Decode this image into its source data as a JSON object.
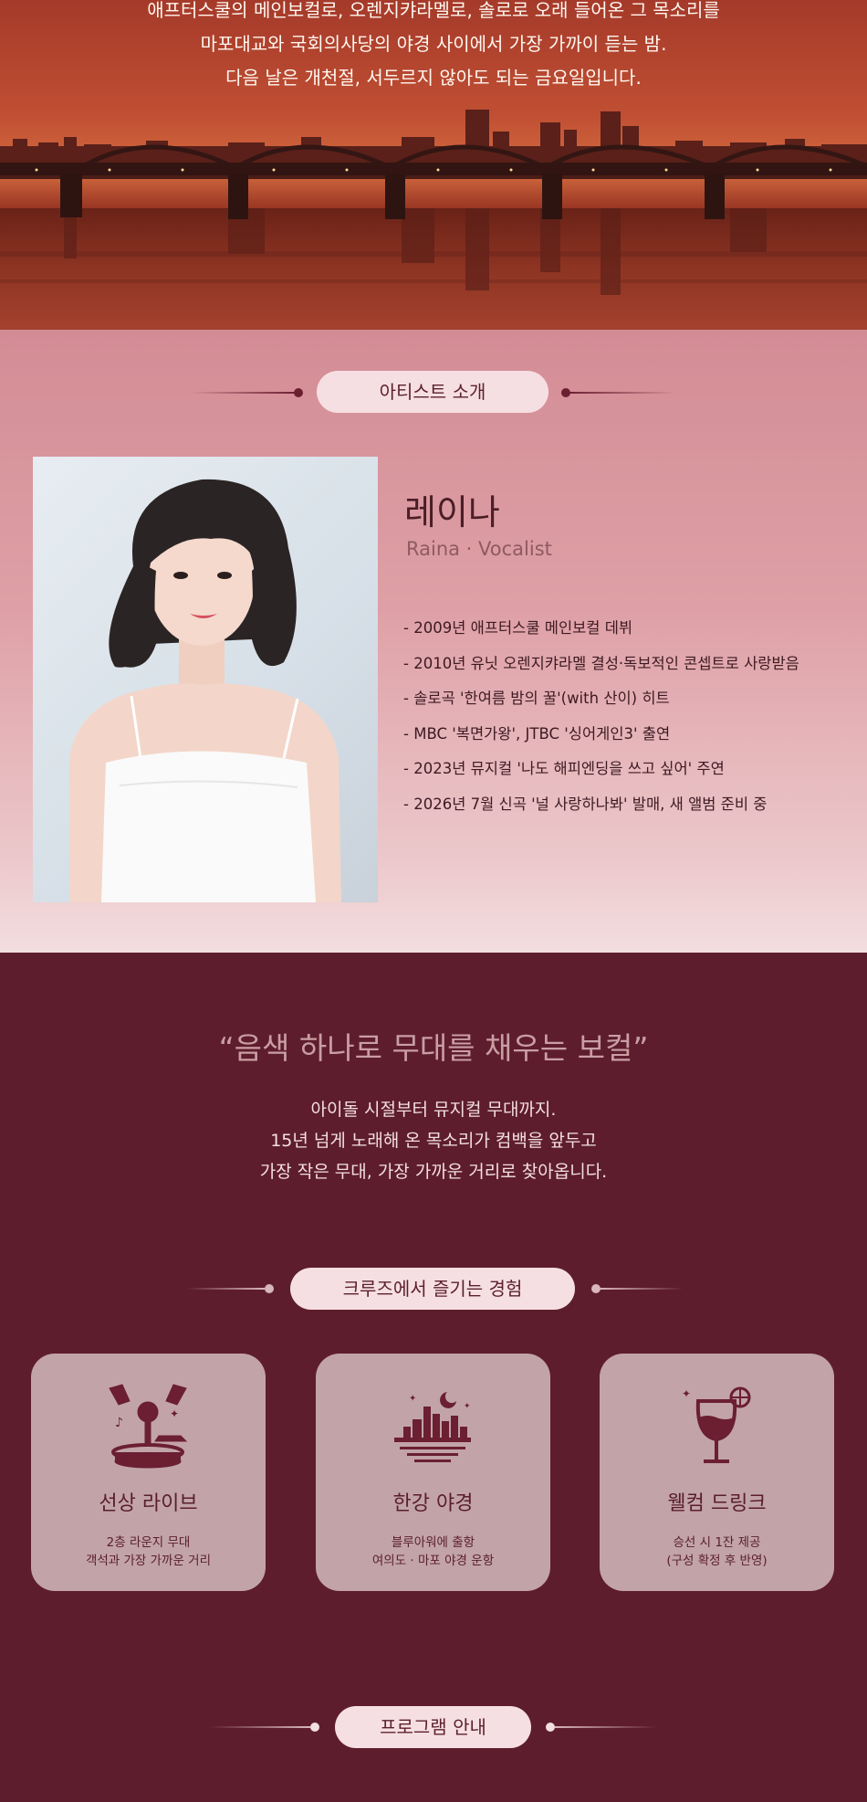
{
  "hero": {
    "lines": [
      "애프터스쿨의 메인보컬로, 오렌지캬라멜로, 솔로로 오래 들어온 그 목소리를",
      "마포대교와 국회의사당의 야경 사이에서 가장 가까이 듣는 밤.",
      "다음 날은 개천절, 서두르지 않아도 되는 금요일입니다."
    ]
  },
  "artist": {
    "section_title": "아티스트 소개",
    "name": "레이나",
    "subtitle": "Raina · Vocalist",
    "bio": [
      "2009년 애프터스쿨 메인보컬 데뷔",
      "2010년 유닛 오렌지캬라멜 결성·독보적인 콘셉트로 사랑받음",
      "솔로곡 '한여름 밤의 꿀'(with 산이) 히트",
      "MBC '복면가왕', JTBC '싱어게인3' 출연",
      "2023년 뮤지컬 '나도 해피엔딩을 쓰고 싶어' 주연",
      "2026년 7월 신곡 '널 사랑하나봐' 발매, 새 앨범 준비 중"
    ]
  },
  "intro": {
    "quote": "“음색 하나로 무대를 채우는 보컬”",
    "lines": [
      "아이돌 시절부터 뮤지컬 무대까지.",
      "15년 넘게 노래해 온 목소리가 컴백을 앞두고",
      "가장 작은 무대, 가장 가까운 거리로 찾아옵니다."
    ]
  },
  "experience": {
    "section_title": "크루즈에서 즐기는 경험",
    "cards": [
      {
        "icon": "microphone-stage-icon",
        "title": "선상 라이브",
        "desc": [
          "2층 라운지 무대",
          "객석과 가장 가까운 거리"
        ]
      },
      {
        "icon": "city-night-icon",
        "title": "한강 야경",
        "desc": [
          "블루아워에 출항",
          "여의도 · 마포 야경 운항"
        ]
      },
      {
        "icon": "wine-glass-icon",
        "title": "웰컴 드링크",
        "desc": [
          "승선 시 1잔 제공",
          "(구성 확정 후 반영)"
        ]
      }
    ]
  },
  "program": {
    "section_title": "프로그램 안내"
  },
  "colors": {
    "wine": "#5e1d2c",
    "pill": "#f6dfe2",
    "card": "#c2a4a8",
    "accent": "#6b1f30"
  }
}
